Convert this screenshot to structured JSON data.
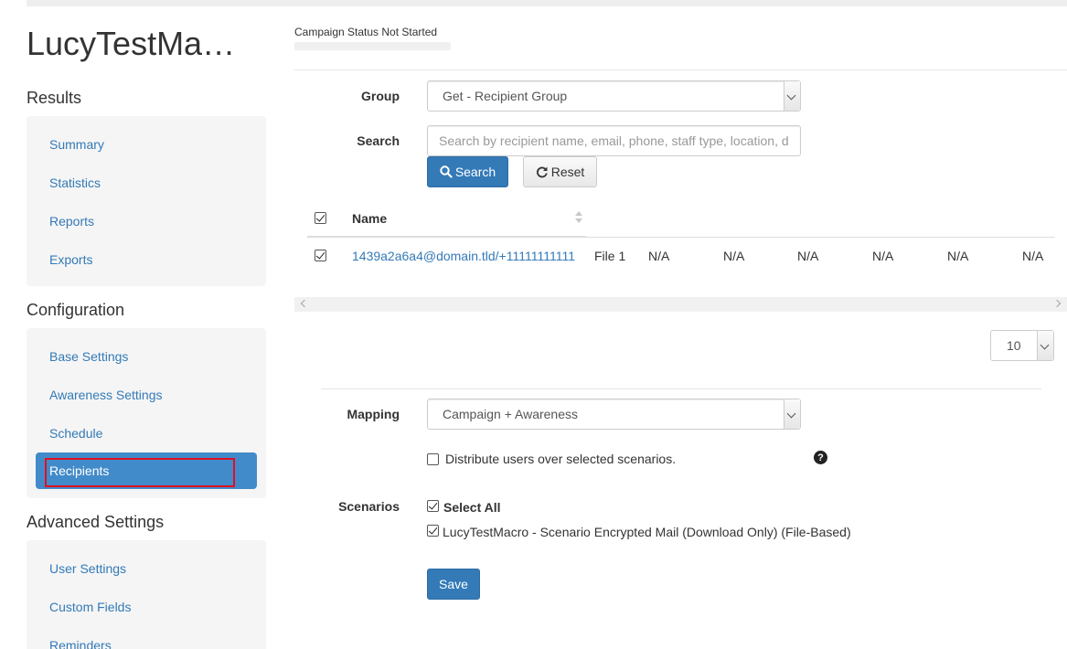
{
  "campaign": {
    "title": "LucyTestMa…",
    "status_text": "Campaign Status Not Started"
  },
  "sidebar": {
    "results": {
      "heading": "Results",
      "items": [
        {
          "label": "Summary"
        },
        {
          "label": "Statistics"
        },
        {
          "label": "Reports"
        },
        {
          "label": "Exports"
        }
      ]
    },
    "configuration": {
      "heading": "Configuration",
      "items": [
        {
          "label": "Base Settings"
        },
        {
          "label": "Awareness Settings"
        },
        {
          "label": "Schedule"
        },
        {
          "label": "Recipients",
          "active": true
        }
      ]
    },
    "advanced": {
      "heading": "Advanced Settings",
      "items": [
        {
          "label": "User Settings"
        },
        {
          "label": "Custom Fields"
        },
        {
          "label": "Reminders"
        }
      ]
    }
  },
  "filters": {
    "group_label": "Group",
    "group_value": "Get - Recipient Group",
    "search_label": "Search",
    "search_placeholder": "Search by recipient name, email, phone, staff type, location, department",
    "search_button": "Search",
    "reset_button": "Reset"
  },
  "table": {
    "header_name": "Name",
    "rows": [
      {
        "checked": true,
        "name": "1439a2a6a4@domain.tld/+11111111111",
        "file": "File 1",
        "values": [
          "N/A",
          "N/A",
          "N/A",
          "N/A",
          "N/A",
          "N/A"
        ]
      }
    ]
  },
  "pagination": {
    "page_size": "10"
  },
  "mapping": {
    "label": "Mapping",
    "value": "Campaign + Awareness",
    "distribute_label": "Distribute users over selected scenarios.",
    "distribute_checked": false
  },
  "scenarios": {
    "label": "Scenarios",
    "select_all_label": "Select All",
    "items": [
      {
        "label": "LucyTestMacro - Scenario Encrypted Mail (Download Only) (File-Based)",
        "checked": true
      }
    ]
  },
  "save_button": "Save",
  "colors": {
    "link": "#337ab7",
    "primary": "#337ab7",
    "nav_active": "#428bca",
    "highlight": "#e0101f"
  }
}
